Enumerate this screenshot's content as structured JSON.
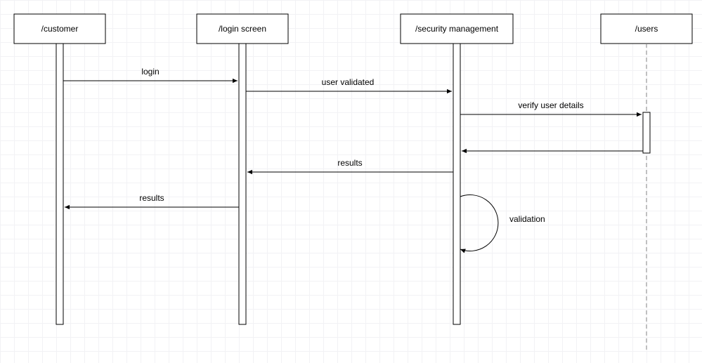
{
  "diagram": {
    "type": "sequence",
    "participants": [
      {
        "id": "customer",
        "label": "/customer"
      },
      {
        "id": "login_screen",
        "label": "/login screen"
      },
      {
        "id": "security_management",
        "label": "/security management"
      },
      {
        "id": "users",
        "label": "/users"
      }
    ],
    "messages": {
      "login": "login",
      "user_validated": "user validated",
      "verify_user_details": "verify user details",
      "results_sm_to_ls": "results",
      "results_ls_to_cust": "results",
      "validation": "validation"
    }
  }
}
